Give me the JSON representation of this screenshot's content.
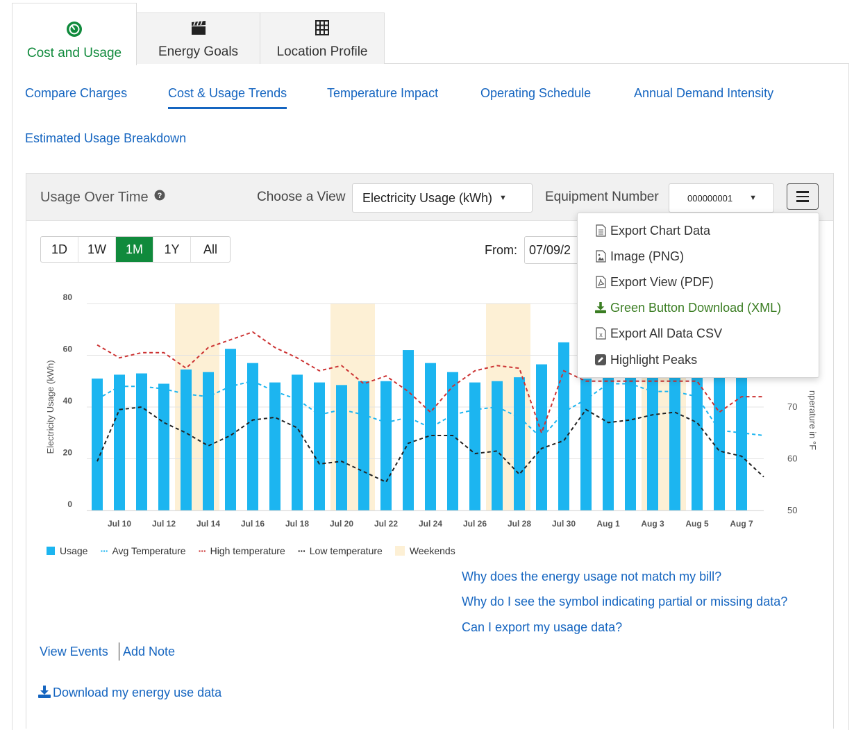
{
  "main_tabs": [
    {
      "label": "Cost and Usage",
      "icon": "gauge-icon",
      "active": true
    },
    {
      "label": "Energy Goals",
      "icon": "clapperboard-icon",
      "active": false
    },
    {
      "label": "Location Profile",
      "icon": "building-icon",
      "active": false
    }
  ],
  "sub_tabs": [
    {
      "label": "Compare Charges"
    },
    {
      "label": "Cost & Usage Trends",
      "active": true
    },
    {
      "label": "Temperature Impact"
    },
    {
      "label": "Operating Schedule"
    },
    {
      "label": "Annual Demand Intensity"
    },
    {
      "label": "Estimated Usage Breakdown"
    }
  ],
  "card": {
    "title": "Usage Over Time",
    "help_icon": "question-circle-icon",
    "view_label": "Choose a View",
    "view_value": "Electricity Usage (kWh)",
    "equipment_label": "Equipment Number",
    "equipment_value": "000000001",
    "menu_icon": "hamburger-icon"
  },
  "range_buttons": [
    "1D",
    "1W",
    "1M",
    "1Y",
    "All"
  ],
  "range_active": "1M",
  "date_filter": {
    "from_label": "From:",
    "from_value": "07/09/2"
  },
  "export_menu": [
    {
      "label": "Export Chart Data",
      "icon": "document-icon"
    },
    {
      "label": "Image (PNG)",
      "icon": "image-file-icon"
    },
    {
      "label": "Export View (PDF)",
      "icon": "pdf-file-icon"
    },
    {
      "label": "Green Button Download (XML)",
      "icon": "download-icon",
      "color": "#3a7d22"
    },
    {
      "label": "Export All Data CSV",
      "icon": "excel-file-icon"
    },
    {
      "label": "Highlight Peaks",
      "icon": "pencil-square-icon"
    }
  ],
  "chart_data": {
    "type": "bar",
    "title": "",
    "ylabel": "Electricity Usage (kWh)",
    "y2label": "Temperature in °F",
    "y2label_visible": "nperature in °F",
    "ylim": [
      0,
      80
    ],
    "y2lim": [
      50,
      90
    ],
    "yticks": [
      0,
      20,
      40,
      60,
      80
    ],
    "y2ticks": [
      50,
      60,
      70
    ],
    "x_tick_labels": [
      "Jul 10",
      "Jul 12",
      "Jul 14",
      "Jul 16",
      "Jul 18",
      "Jul 20",
      "Jul 22",
      "Jul 24",
      "Jul 26",
      "Jul 28",
      "Jul 30",
      "Aug 1",
      "Aug 3",
      "Aug 5",
      "Aug 7"
    ],
    "categories": [
      "Jul 9",
      "Jul 10",
      "Jul 11",
      "Jul 12",
      "Jul 13",
      "Jul 14",
      "Jul 15",
      "Jul 16",
      "Jul 17",
      "Jul 18",
      "Jul 19",
      "Jul 20",
      "Jul 21",
      "Jul 22",
      "Jul 23",
      "Jul 24",
      "Jul 25",
      "Jul 26",
      "Jul 27",
      "Jul 28",
      "Jul 29",
      "Jul 30",
      "Jul 31",
      "Aug 1",
      "Aug 2",
      "Aug 3",
      "Aug 4",
      "Aug 5",
      "Aug 6",
      "Aug 7",
      "Aug 8"
    ],
    "weekend_days": [
      "Jul 13",
      "Jul 14",
      "Jul 20",
      "Jul 21",
      "Jul 27",
      "Jul 28",
      "Aug 3",
      "Aug 4"
    ],
    "series": [
      {
        "name": "Usage",
        "axis": "left",
        "style": "bar",
        "color": "#1cb5f0",
        "values": [
          51,
          52.5,
          53,
          49,
          54.5,
          53.5,
          62.5,
          57,
          49.5,
          52.5,
          49.5,
          48.5,
          50,
          50,
          62,
          57,
          53.5,
          49.5,
          50,
          51.5,
          56.5,
          65,
          51,
          53,
          53,
          53,
          52,
          52,
          52,
          52,
          null
        ]
      },
      {
        "name": "Avg Temperature",
        "axis": "right",
        "style": "dashed",
        "color": "#1cb5f0",
        "values": [
          71.5,
          74,
          74,
          73.5,
          72.5,
          72,
          74,
          75,
          73,
          71.5,
          68.5,
          69.5,
          68.5,
          67,
          68,
          66,
          68.5,
          69.5,
          70,
          68,
          64,
          69,
          71.5,
          74.5,
          74.5,
          73,
          73,
          72,
          65.5,
          65,
          64.5
        ]
      },
      {
        "name": "High temperature",
        "axis": "right",
        "style": "dashed",
        "color": "#cc3333",
        "values": [
          82,
          79.5,
          80.5,
          80.5,
          77.5,
          81.5,
          83,
          84.5,
          81.5,
          79.5,
          77,
          78,
          74.5,
          76,
          73,
          69,
          74,
          77,
          78,
          77.5,
          65,
          77,
          75,
          75,
          75,
          75,
          75,
          75,
          69,
          72,
          72
        ]
      },
      {
        "name": "Low temperature",
        "axis": "right",
        "style": "dashed",
        "color": "#222222",
        "values": [
          59.5,
          69.5,
          70,
          67,
          65,
          62.5,
          64.5,
          67.5,
          68,
          66,
          59,
          59.5,
          57.5,
          55.5,
          63,
          64.5,
          64.5,
          61,
          61.5,
          57,
          62,
          63.5,
          69.5,
          67,
          67.5,
          68.5,
          69,
          67,
          61.5,
          60.5,
          56.5
        ]
      }
    ],
    "legend": [
      {
        "name": "Usage",
        "marker": "square",
        "color": "#1cb5f0"
      },
      {
        "name": "Avg Temperature",
        "marker": "dots",
        "color": "#1cb5f0"
      },
      {
        "name": "High temperature",
        "marker": "dots",
        "color": "#cc3333"
      },
      {
        "name": "Low temperature",
        "marker": "dots",
        "color": "#222222"
      },
      {
        "name": "Weekends",
        "marker": "square",
        "color": "#fdf0d5"
      }
    ],
    "grid": "horizontal",
    "legend_position": "bottom-left"
  },
  "faq_links": [
    "Why does the energy usage not match my bill?",
    "Why do I see the symbol indicating partial or missing data?",
    "Can I export my usage data?"
  ],
  "actions": {
    "view_events": "View Events",
    "add_note": "Add Note",
    "download": "Download my energy use data",
    "download_icon": "download-icon"
  },
  "colors": {
    "brand_green": "#108a3c",
    "link_blue": "#1565c0",
    "usage_bar": "#1cb5f0",
    "weekend": "#fdf0d5"
  }
}
